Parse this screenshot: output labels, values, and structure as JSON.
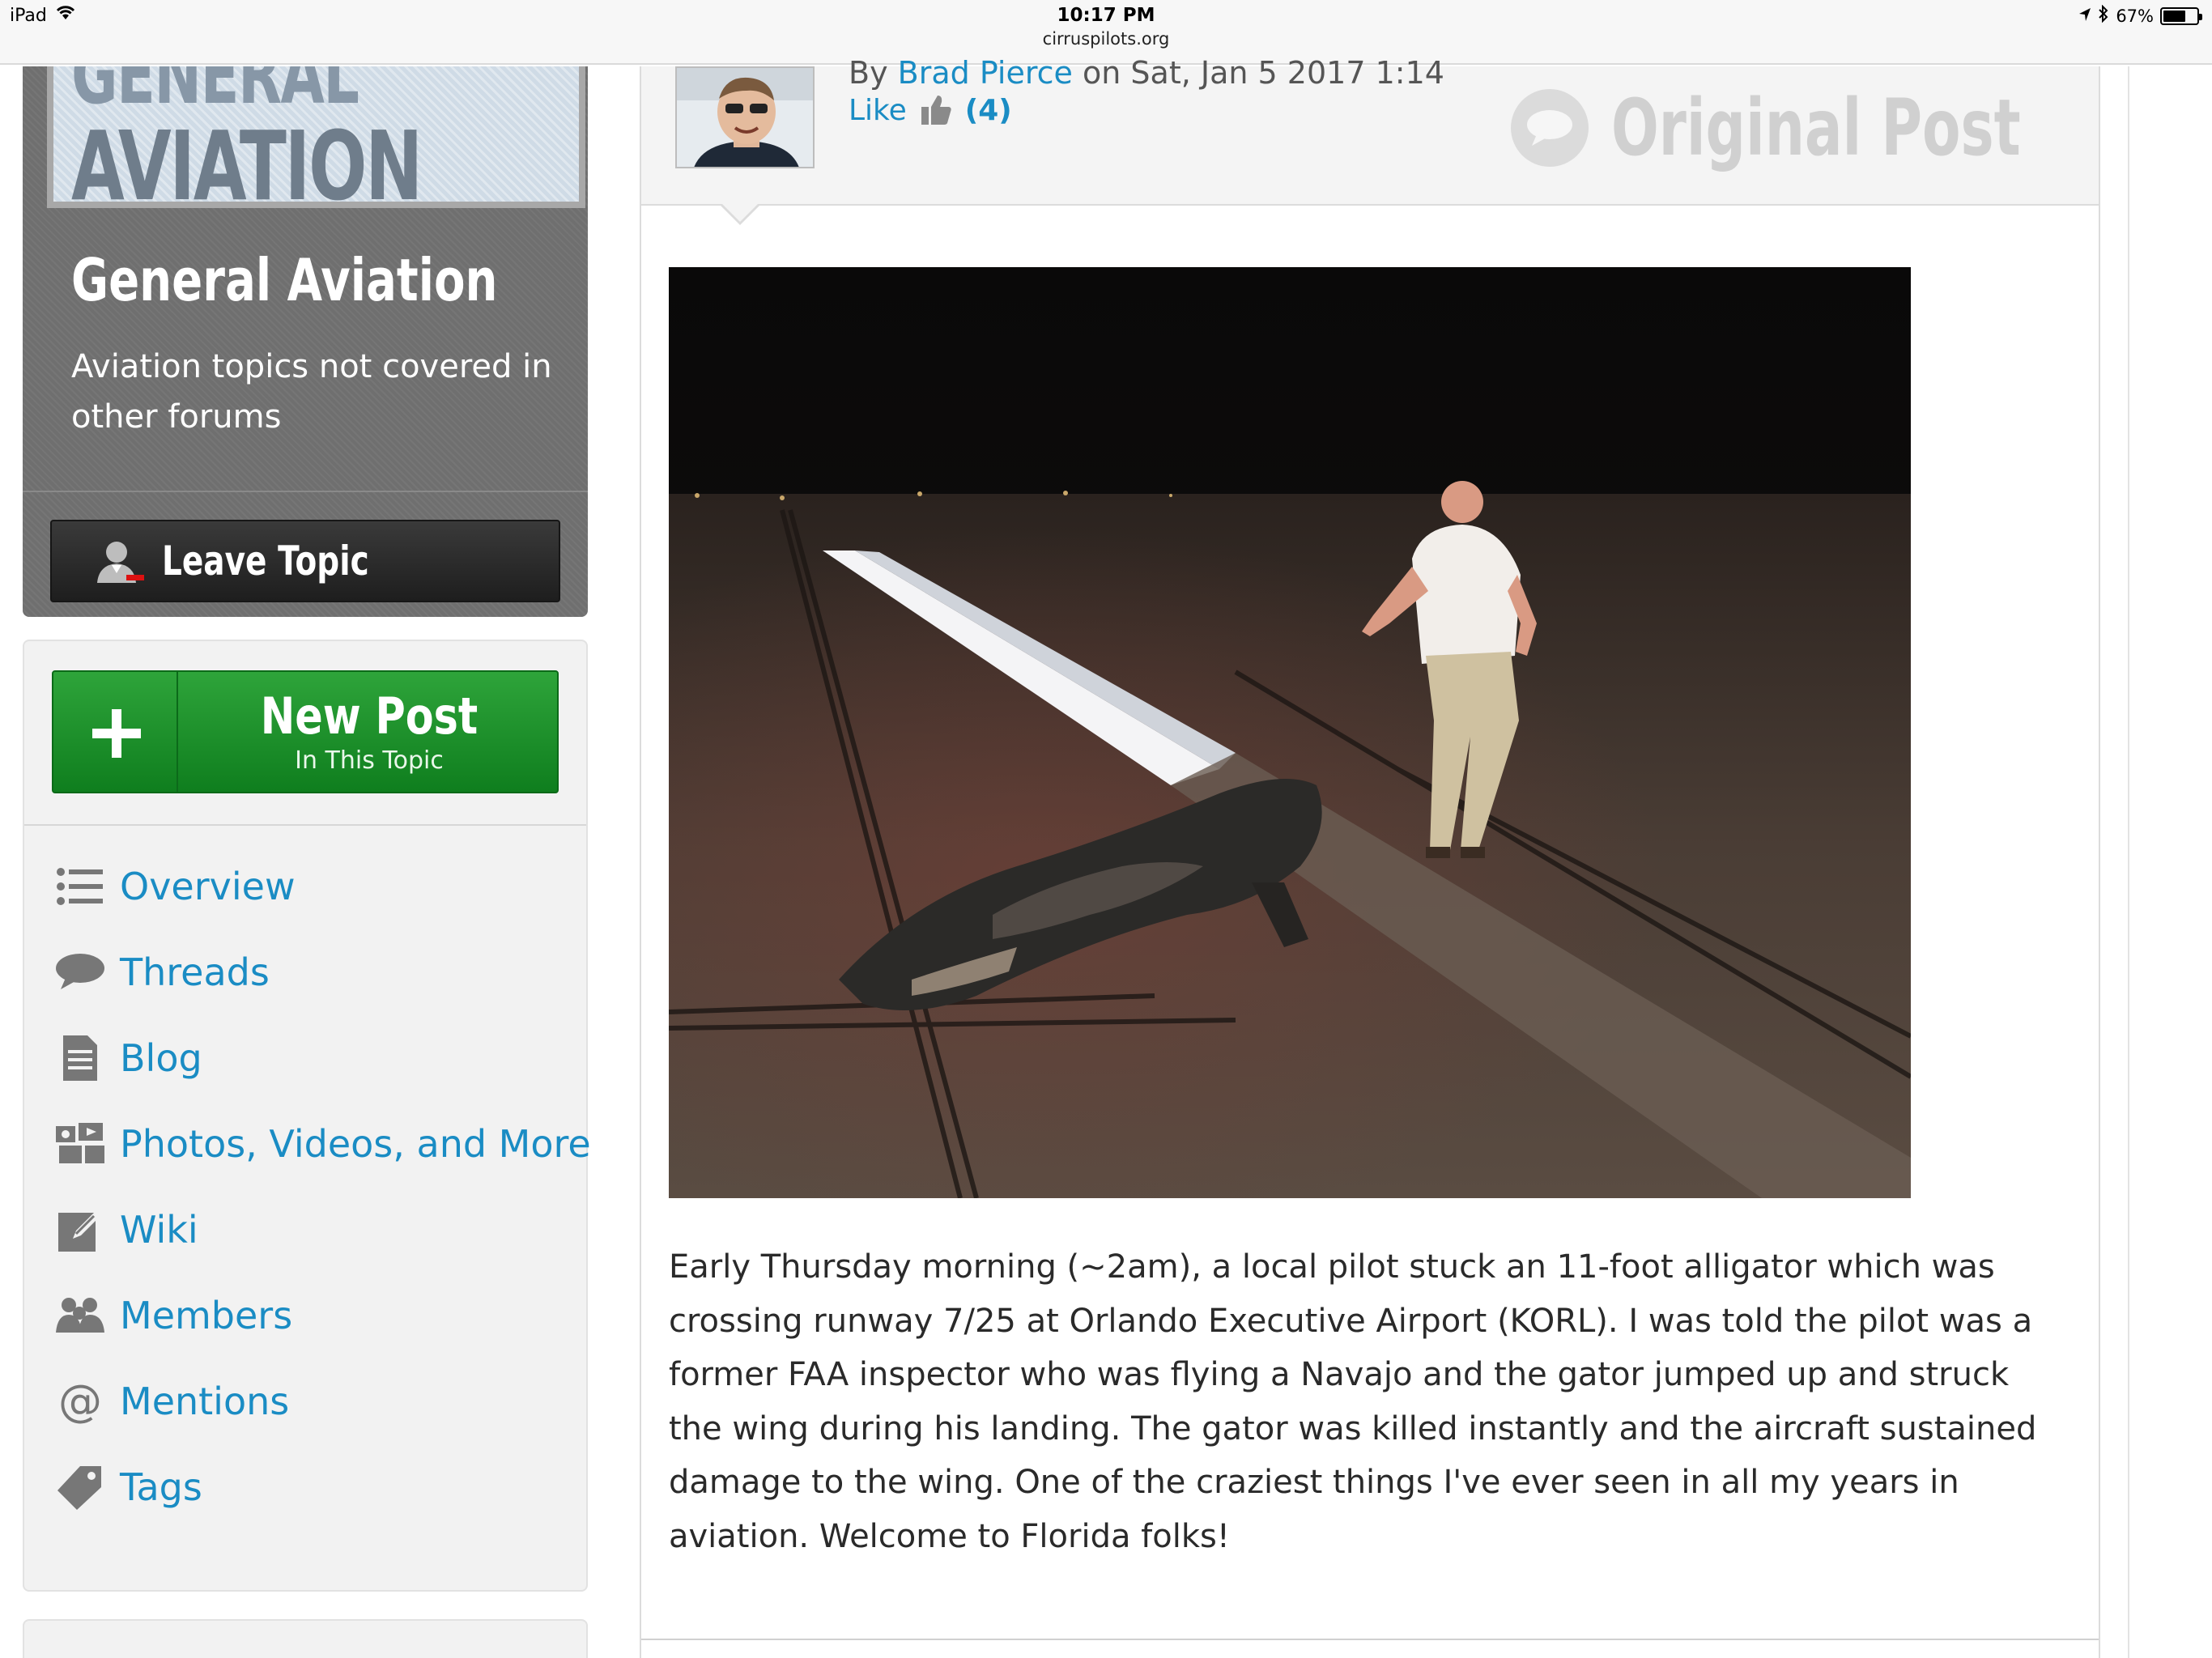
{
  "status_bar": {
    "device": "iPad",
    "time": "10:17 PM",
    "url": "cirruspilots.org",
    "battery": "67%",
    "battery_level": 0.67
  },
  "topic": {
    "banner_line1": "GENERAL",
    "banner_line2": "AVIATION",
    "title": "General Aviation",
    "description": "Aviation topics not covered in other forums",
    "leave_label": "Leave Topic"
  },
  "new_post": {
    "title": "New Post",
    "subtitle": "In This Topic"
  },
  "nav": {
    "items": [
      {
        "label": "Overview",
        "icon": "list-icon"
      },
      {
        "label": "Threads",
        "icon": "speech-bubble-icon"
      },
      {
        "label": "Blog",
        "icon": "document-icon"
      },
      {
        "label": "Photos, Videos, and More",
        "icon": "media-icon"
      },
      {
        "label": "Wiki",
        "icon": "edit-icon"
      },
      {
        "label": "Members",
        "icon": "members-icon"
      },
      {
        "label": "Mentions",
        "icon": "at-icon"
      },
      {
        "label": "Tags",
        "icon": "tag-icon"
      }
    ]
  },
  "post": {
    "by": "By",
    "author": "Brad Pierce",
    "on_date": "on Sat, Jan 5 2017 1:14",
    "like_label": "Like",
    "like_count": "(4)",
    "badge": "Original Post",
    "body": "Early Thursday morning (~2am), a local pilot stuck an 11-foot alligator which was crossing runway 7/25 at Orlando Executive Airport (KORL).  I was told the pilot was a former FAA inspector who was flying a Navajo and the gator jumped up and struck the wing during his landing.  The gator was killed instantly and the aircraft sustained damage to the wing.  One of the craziest things I've ever seen in all my years in aviation.  Welcome to Florida folks!"
  },
  "colors": {
    "link": "#1a8cc4",
    "new_post_green": "#1a8f2a",
    "topic_card_gray": "#6f6f6f"
  }
}
